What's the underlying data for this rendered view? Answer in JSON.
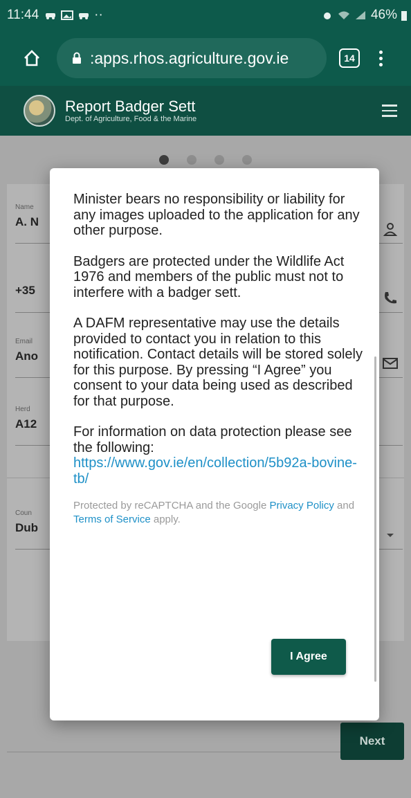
{
  "status_bar": {
    "time": "11:44",
    "notification_icons": [
      "car-icon",
      "image-icon",
      "car-icon"
    ],
    "more_dots": "··",
    "battery": "46%"
  },
  "browser": {
    "url": ":apps.rhos.agriculture.gov.ie",
    "tab_count": "14"
  },
  "app_header": {
    "title": "Report Badger Sett",
    "subtitle": "Dept. of Agriculture, Food & the Marine"
  },
  "stepper": {
    "total": 4,
    "active": 1
  },
  "form": {
    "name": {
      "label": "Name",
      "value": "A. N"
    },
    "phone": {
      "label": "",
      "value": "+35"
    },
    "email": {
      "label": "Email",
      "value": "Ano"
    },
    "herd": {
      "label": "Herd",
      "value": "A12"
    },
    "county": {
      "label": "Coun",
      "value": "Dub"
    }
  },
  "modal": {
    "para1": "Minister bears no responsibility or liability for any images uploaded to the application for any other purpose.",
    "para2": "Badgers are protected under the Wildlife Act 1976 and members of the public must not to interfere with a badger sett.",
    "para3": "A DAFM representative may use the details provided to contact you in relation to this notification. Contact details will be stored solely for this purpose. By pressing “I Agree” you consent to your data being used as described for that purpose.",
    "para4": "For information on data protection please see the following:",
    "link": "https://www.gov.ie/en/collection/5b92a-bovine-tb/",
    "recaptcha_prefix": "Protected by reCAPTCHA and the Google",
    "privacy_link": "Privacy Policy",
    "recaptcha_and": "and",
    "terms_link": "Terms of Service",
    "recaptcha_suffix": "apply.",
    "agree_label": "I Agree"
  },
  "footer": {
    "next_label": "Next"
  },
  "colors": {
    "primary": "#0d5a4b",
    "header": "#0f4f42",
    "link": "#1e90c7"
  }
}
